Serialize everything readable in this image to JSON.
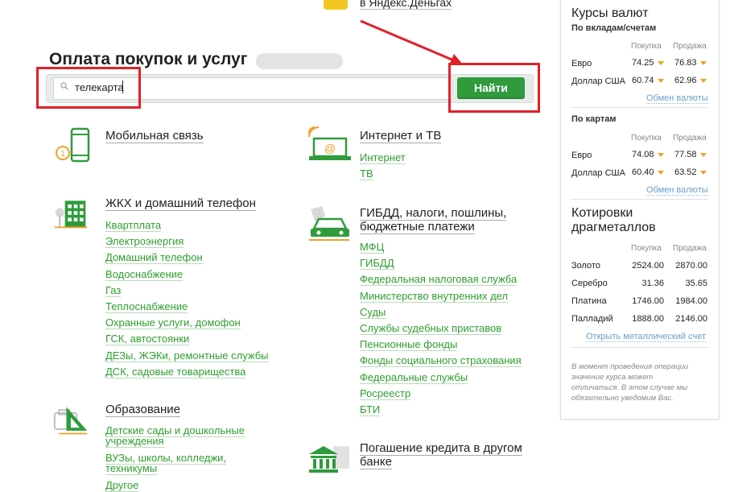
{
  "promo": {
    "text": "в Яндекс.Деньгах"
  },
  "page_title": "Оплата покупок и услуг",
  "search": {
    "value": "телекарта",
    "button_label": "Найти"
  },
  "categories_left": [
    {
      "title": "Мобильная связь",
      "links": []
    },
    {
      "title": "ЖКХ и домашний телефон",
      "links": [
        "Квартплата",
        "Электроэнергия",
        "Домашний телефон",
        "Водоснабжение",
        "Газ",
        "Теплоснабжение",
        "Охранные услуги, домофон",
        "ГСК, автостоянки",
        "ДЕЗы, ЖЭКи, ремонтные службы",
        "ДСК, садовые товарищества"
      ]
    },
    {
      "title": "Образование",
      "links": [
        "Детские сады и дошкольные учреждения",
        "ВУЗы, школы, колледжи, техникумы",
        "Другое"
      ]
    }
  ],
  "categories_right": [
    {
      "title": "Интернет и ТВ",
      "links": [
        "Интернет",
        "ТВ"
      ]
    },
    {
      "title_line1": "ГИБДД, налоги, пошлины,",
      "title_line2": "бюджетные платежи",
      "links": [
        "МФЦ",
        "ГИБДД",
        "Федеральная налоговая служба",
        "Министерство внутренних дел",
        "Суды",
        "Службы судебных приставов",
        "Пенсионные фонды",
        "Фонды социального страхования",
        "Федеральные службы",
        "Росреестр",
        "БТИ"
      ]
    },
    {
      "title_line1": "Погашение кредита в другом",
      "title_line2": "банке"
    }
  ],
  "rates": {
    "title": "Курсы валют",
    "deposits": {
      "subtitle": "По вкладам/счетам",
      "col_buy": "Покупка",
      "col_sell": "Продажа",
      "rows": [
        {
          "name": "Евро",
          "buy": "74.25",
          "sell": "76.83"
        },
        {
          "name": "Доллар США",
          "buy": "60.74",
          "sell": "62.96"
        }
      ],
      "link": "Обмен валюты"
    },
    "cards": {
      "subtitle": "По картам",
      "col_buy": "Покупка",
      "col_sell": "Продажа",
      "rows": [
        {
          "name": "Евро",
          "buy": "74.08",
          "sell": "77.58"
        },
        {
          "name": "Доллар США",
          "buy": "60.40",
          "sell": "63.52"
        }
      ],
      "link": "Обмен валюты"
    }
  },
  "metals": {
    "title_line1": "Котировки",
    "title_line2": "драгметаллов",
    "col_buy": "Покупка",
    "col_sell": "Продажа",
    "rows": [
      {
        "name": "Золото",
        "buy": "2524.00",
        "sell": "2870.00"
      },
      {
        "name": "Серебро",
        "buy": "31.36",
        "sell": "35.65"
      },
      {
        "name": "Платина",
        "buy": "1746.00",
        "sell": "1984.00"
      },
      {
        "name": "Палладий",
        "buy": "1888.00",
        "sell": "2146.00"
      }
    ],
    "link": "Открыть металлический счет",
    "note_lines": [
      "В момент проведения операции",
      "значение курса может",
      "отличаться. В этом случае мы",
      "обязательно уведомим Вас."
    ]
  },
  "colors": {
    "accent_green": "#2f9b3c",
    "link_green": "#2e9e2e",
    "highlight_red": "#e0212a",
    "trend_orange": "#f0a020"
  }
}
